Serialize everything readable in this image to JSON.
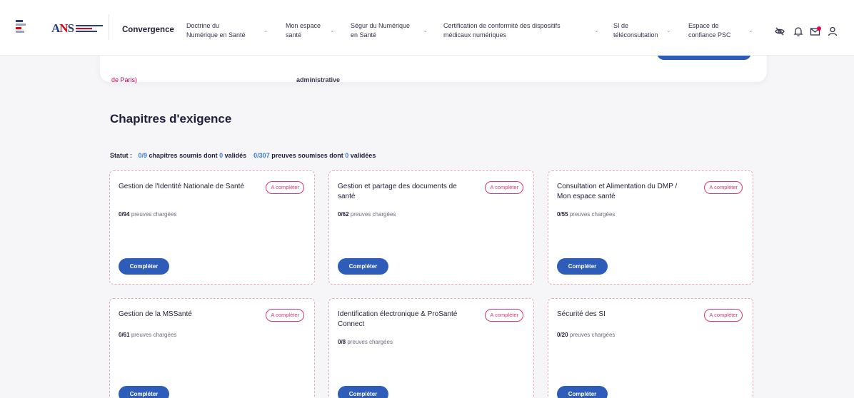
{
  "header": {
    "brand": "Convergence",
    "nav": [
      {
        "line1": "Doctrine du",
        "line2": "Numérique en Santé"
      },
      {
        "line1": "Mon espace",
        "line2": "santé"
      },
      {
        "line1": "Ségur du Numérique",
        "line2": "en Santé"
      },
      {
        "line1": "Certification de conformité des dispositifs",
        "line2": "médicaux numériques"
      },
      {
        "line1": "SI de",
        "line2": "téléconsultation"
      },
      {
        "line1": "Espace de",
        "line2": "confiance PSC"
      }
    ],
    "icons": [
      "eye-off-icon",
      "bell-icon",
      "mail-icon",
      "user-icon"
    ],
    "colors": {
      "accent": "#2d5db8",
      "notification": "#e1004f"
    }
  },
  "top_card": {
    "link_text": "de Paris)",
    "admin_text": "administrative"
  },
  "main": {
    "title": "Chapitres d'exigence",
    "status": {
      "label": "Statut :",
      "chap_ratio": "0/9",
      "chap_text": "chapitres soumis dont",
      "chap_valid": "0",
      "chap_valid_text": "validés",
      "proof_ratio": "0/307",
      "proof_text": "preuves soumises dont",
      "proof_valid": "0",
      "proof_valid_text": "validées"
    },
    "chapters": [
      {
        "title": "Gestion de l'Identité Nationale de Santé",
        "badge": "A compléter",
        "count": "0/94",
        "count_text": "preuves chargées",
        "button": "Compléter"
      },
      {
        "title": "Gestion et partage des documents de santé",
        "badge": "A compléter",
        "count": "0/62",
        "count_text": "preuves chargées",
        "button": "Compléter"
      },
      {
        "title": "Consultation et Alimentation du DMP / Mon espace santé",
        "badge": "A compléter",
        "count": "0/55",
        "count_text": "preuves chargées",
        "button": "Compléter"
      },
      {
        "title": "Gestion de la MSSanté",
        "badge": "A compléter",
        "count": "0/61",
        "count_text": "preuves chargées",
        "button": "Compléter"
      },
      {
        "title": "Identification électronique & ProSanté Connect",
        "badge": "A compléter",
        "count": "0/8",
        "count_text": "preuves chargées",
        "button": "Compléter"
      },
      {
        "title": "Sécurité des SI",
        "badge": "A compléter",
        "count": "0/20",
        "count_text": "preuves chargées",
        "button": "Compléter"
      }
    ]
  }
}
